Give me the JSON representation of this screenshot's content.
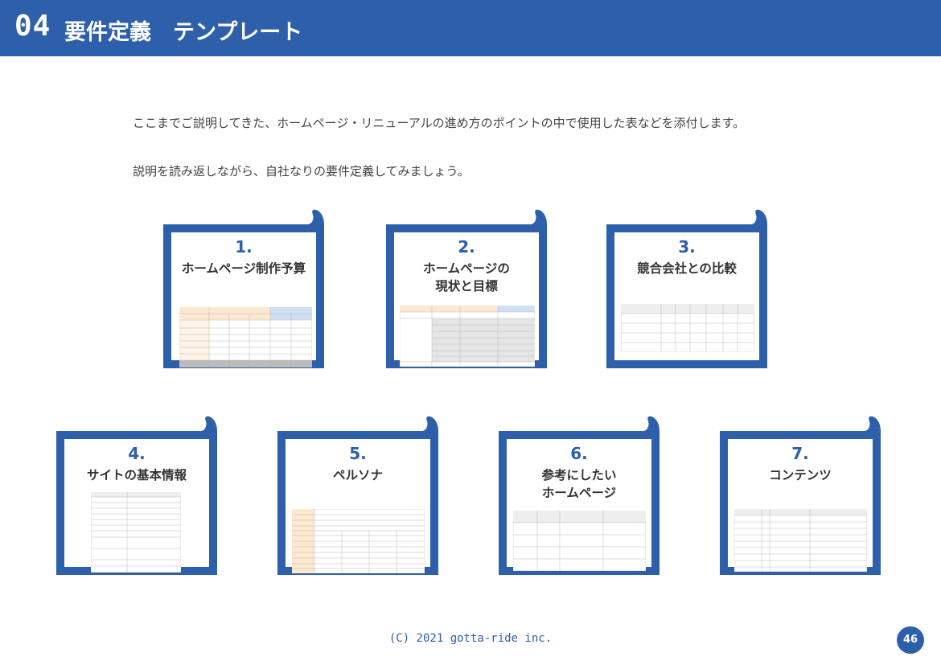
{
  "header": {
    "number": "04",
    "title": "要件定義　テンプレート"
  },
  "intro": [
    "ここまでご説明してきた、ホームページ・リニューアルの進め方のポイントの中で使用した表などを添付します。",
    "説明を読み返しながら、自社なりの要件定義してみましょう。"
  ],
  "cards": [
    {
      "number": "1.",
      "title": "ホームページ制作予算",
      "thumb": "budget-table-thumbnail"
    },
    {
      "number": "2.",
      "title": "ホームページの\n現状と目標",
      "thumb": "status-goal-table-thumbnail"
    },
    {
      "number": "3.",
      "title": "競合会社との比較",
      "thumb": "competitor-table-thumbnail"
    },
    {
      "number": "4.",
      "title": "サイトの基本情報",
      "thumb": "site-info-table-thumbnail"
    },
    {
      "number": "5.",
      "title": "ペルソナ",
      "thumb": "persona-table-thumbnail"
    },
    {
      "number": "6.",
      "title": "参考にしたい\nホームページ",
      "thumb": "reference-sites-table-thumbnail"
    },
    {
      "number": "7.",
      "title": "コンテンツ",
      "thumb": "contents-table-thumbnail"
    }
  ],
  "colors": {
    "brand": "#2d5fab",
    "header_text": "#ffffff",
    "thumb_orange": "#fce9cf",
    "thumb_blue": "#cfe0f3",
    "thumb_grey": "#e6e6e6"
  },
  "footer": {
    "copyright": "(C) 2021 gotta-ride inc.",
    "page": "46"
  }
}
